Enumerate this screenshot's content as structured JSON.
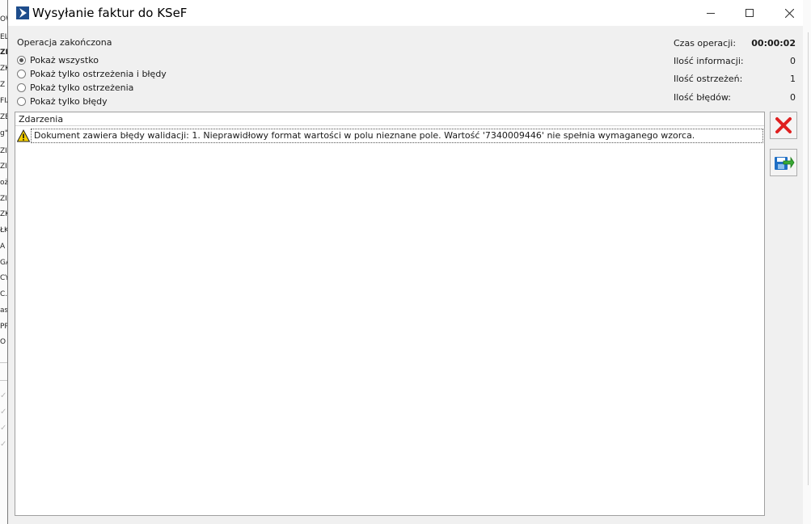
{
  "background_app": {
    "fragments": [
      "OW",
      "ELN",
      "ZIE",
      "ZK",
      "Z O",
      "FIA",
      "ZE",
      "g\"",
      "ZIE",
      "ZIE",
      "ożyc",
      "ZIE",
      "ZK",
      "ŁK",
      "A",
      "GA",
      "CY",
      "C.A",
      "ast",
      "PR",
      "O"
    ]
  },
  "window": {
    "title": "Wysyłanie faktur do KSeF",
    "controls": {
      "minimize_icon": "minimize-icon",
      "maximize_icon": "maximize-icon",
      "close_icon": "close-icon"
    }
  },
  "operation": {
    "status": "Operacja zakończona",
    "filters": [
      {
        "label": "Pokaż wszystko",
        "checked": true
      },
      {
        "label": "Pokaż tylko ostrzeżenia i błędy",
        "checked": false
      },
      {
        "label": "Pokaż tylko ostrzeżenia",
        "checked": false
      },
      {
        "label": "Pokaż tylko błędy",
        "checked": false
      }
    ]
  },
  "stats": {
    "time_label": "Czas operacji:",
    "time_value": "00:00:02",
    "info_label": "Ilość informacji:",
    "info_value": "0",
    "warnings_label": "Ilość ostrzeżeń:",
    "warnings_value": "1",
    "errors_label": "Ilość błędów:",
    "errors_value": "0"
  },
  "events": {
    "header": "Zdarzenia",
    "rows": [
      {
        "icon": "warning-icon",
        "text": "Dokument zawiera błędy walidacji:  1. Nieprawidłowy format wartości w polu nieznane pole. Wartość '7340009446' nie spełnia wymaganego wzorca."
      }
    ]
  },
  "side_buttons": {
    "cancel_icon": "red-x-icon",
    "save_icon": "save-export-icon"
  },
  "colors": {
    "dialog_bg": "#f0f0f0",
    "titlebar_bg": "#ffffff",
    "cancel_red": "#e02020",
    "app_icon_blue": "#1e4d8c"
  }
}
